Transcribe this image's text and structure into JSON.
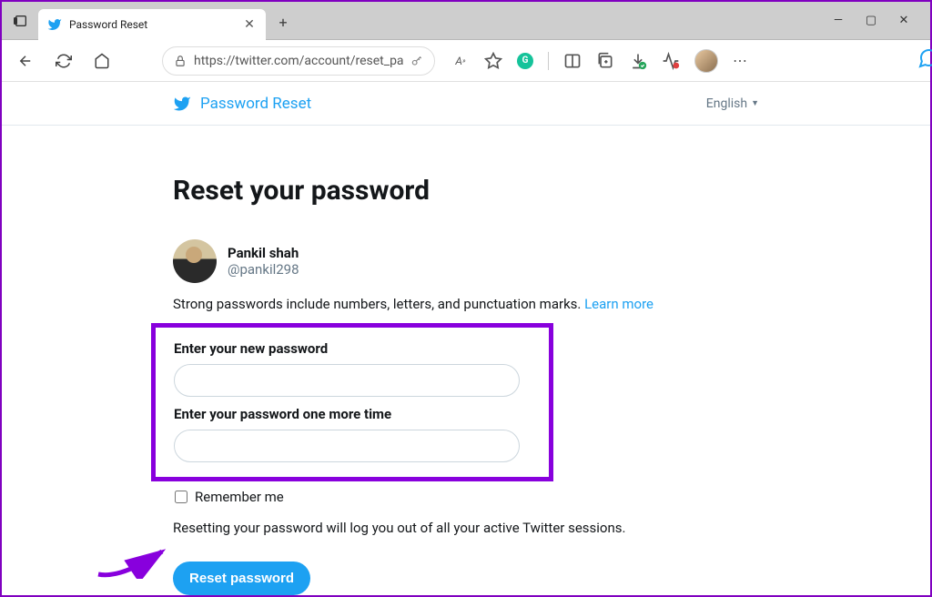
{
  "browser": {
    "tab_title": "Password Reset",
    "url": "https://twitter.com/account/reset_pas...",
    "window_controls": {
      "minimize": "—",
      "maximize": "▢",
      "close": "✕"
    }
  },
  "header": {
    "title": "Password Reset",
    "language": "English"
  },
  "page": {
    "heading": "Reset your password",
    "user": {
      "name": "Pankil shah",
      "handle": "@pankil298"
    },
    "hint": "Strong passwords include numbers, letters, and punctuation marks. ",
    "learn_more": "Learn more",
    "field1_label": "Enter your new password",
    "field2_label": "Enter your password one more time",
    "remember_label": "Remember me",
    "note": "Resetting your password will log you out of all your active Twitter sessions.",
    "button": "Reset password"
  }
}
